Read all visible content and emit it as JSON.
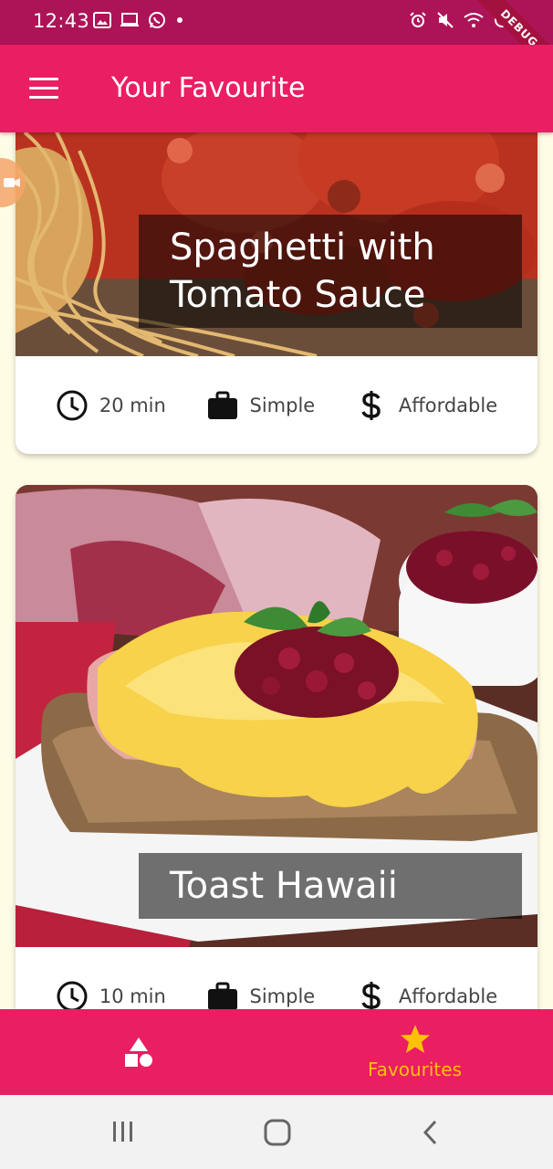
{
  "status_bar": {
    "time": "12:43",
    "debug_label": "DEBUG"
  },
  "app_bar": {
    "title": "Your Favourite"
  },
  "meals": [
    {
      "title": "Spaghetti with Tomato Sauce",
      "duration": "20 min",
      "complexity": "Simple",
      "affordability": "Affordable"
    },
    {
      "title": "Toast Hawaii",
      "duration": "10 min",
      "complexity": "Simple",
      "affordability": "Affordable"
    }
  ],
  "bottom_nav": {
    "categories_label": "Categories",
    "favourites_label": "Favourites",
    "selected": "favourites"
  },
  "colors": {
    "primary": "#E91E63",
    "status_bar": "#AD1457",
    "accent": "#FFC107",
    "background": "#FFFCE6"
  }
}
